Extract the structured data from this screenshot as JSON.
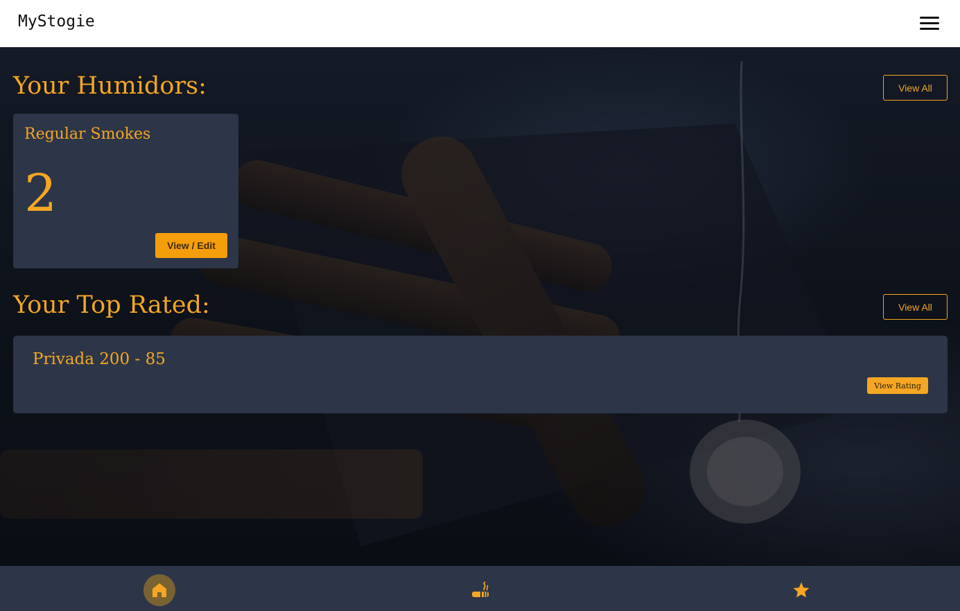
{
  "header": {
    "brand": "MyStogie",
    "menu_icon": "hamburger-menu-icon"
  },
  "humidors": {
    "title": "Your Humidors:",
    "view_all_label": "View All",
    "cards": [
      {
        "name": "Regular Smokes",
        "count": "2",
        "action_label": "View / Edit"
      }
    ]
  },
  "top_rated": {
    "title": "Your Top Rated:",
    "view_all_label": "View All",
    "items": [
      {
        "name": "Privada 200 - 85",
        "action_label": "View Rating"
      }
    ]
  },
  "bottom_nav": {
    "items": [
      {
        "icon": "home-icon",
        "active": true
      },
      {
        "icon": "cigar-icon",
        "active": false
      },
      {
        "icon": "star-icon",
        "active": false
      }
    ]
  },
  "colors": {
    "accent": "#f5a623",
    "card": "#2d3648",
    "header_bg": "#ffffff",
    "nav_bg": "#2d3648"
  }
}
